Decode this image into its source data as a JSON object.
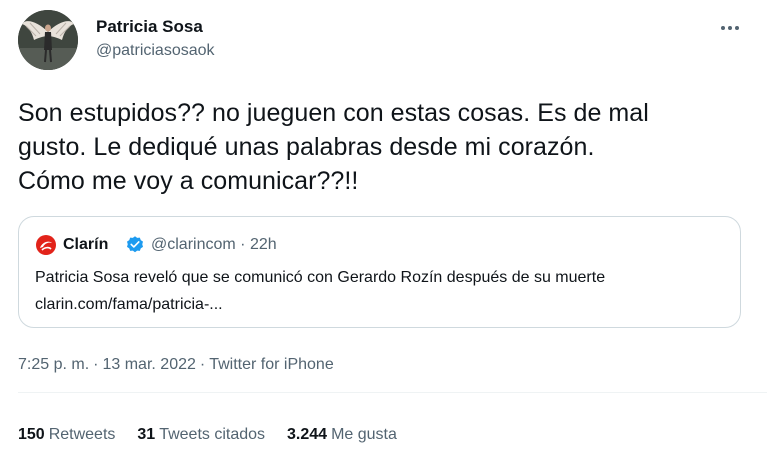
{
  "author": {
    "display_name": "Patricia Sosa",
    "handle": "@patriciasosaok",
    "avatar_icon": "angel-wings-avatar"
  },
  "tweet": {
    "text": "Son estupidos?? no jueguen con estas cosas. Es de mal\ngusto. Le dediqué unas palabras desde mi corazón.\nCómo me voy a comunicar??!!"
  },
  "quote": {
    "logo_icon": "clarin-logo",
    "name": "Clarín",
    "verified_icon": "verified-badge-icon",
    "handle": "@clarincom",
    "separator": "·",
    "time": "22h",
    "text": "Patricia Sosa reveló que se comunicó con Gerardo Rozín después de su muerte",
    "link": "clarin.com/fama/patricia-..."
  },
  "meta": {
    "time": "7:25 p. m.",
    "date": "13 mar. 2022",
    "source": "Twitter for iPhone",
    "separator": "·"
  },
  "stats": {
    "retweets_count": "150",
    "retweets_label": "Retweets",
    "quotes_count": "31",
    "quotes_label": "Tweets citados",
    "likes_count": "3.244",
    "likes_label": "Me gusta"
  },
  "colors": {
    "text_primary": "#0f1419",
    "text_secondary": "#536471",
    "border": "#cfd9de",
    "verified": "#1d9bf0",
    "clarin_red": "#e2231a"
  }
}
